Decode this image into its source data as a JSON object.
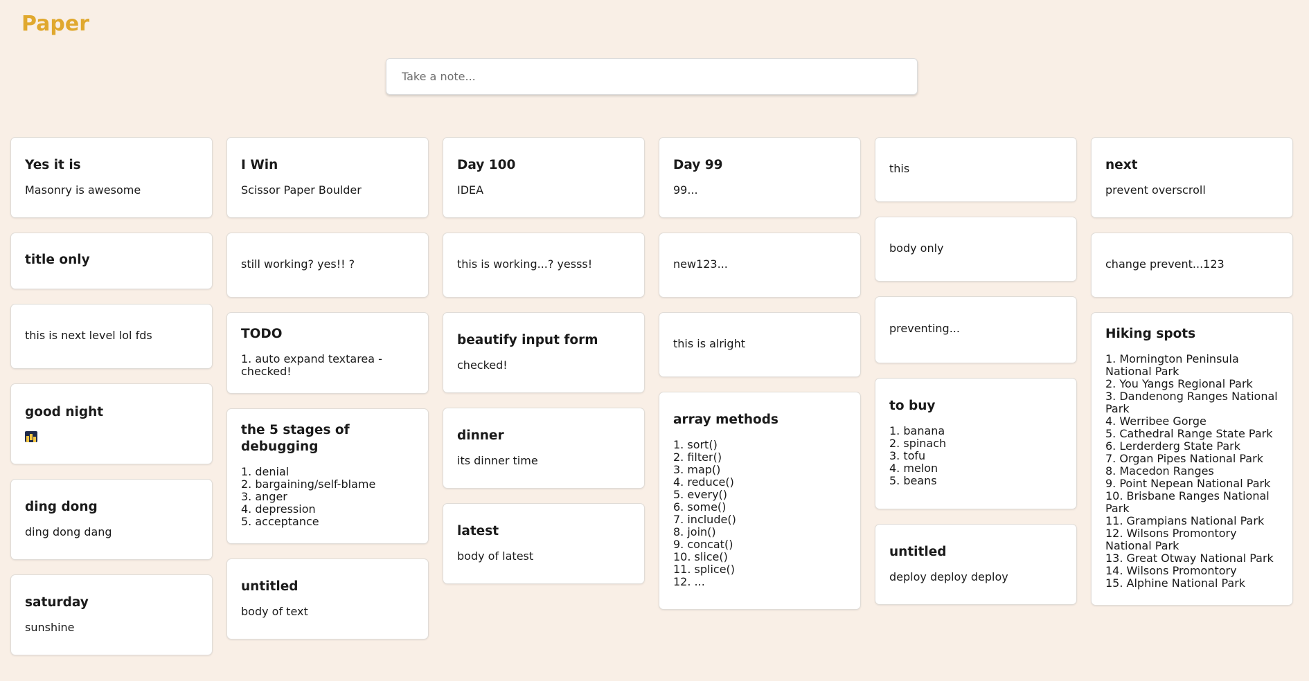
{
  "app": {
    "title": "Paper"
  },
  "input": {
    "placeholder": "Take a note..."
  },
  "columns": [
    [
      {
        "title": "Yes it is",
        "body": "Masonry is awesome"
      },
      {
        "title": "title only",
        "body": ""
      },
      {
        "title": "",
        "body": "this is next level lol fds"
      },
      {
        "title": "good night",
        "body": "",
        "icon": "night-city-icon"
      },
      {
        "title": "ding dong",
        "body": "ding dong dang"
      },
      {
        "title": "saturday",
        "body": "sunshine"
      }
    ],
    [
      {
        "title": "I Win",
        "body": "Scissor Paper Boulder"
      },
      {
        "title": "",
        "body": "still working? yes!! ?"
      },
      {
        "title": "TODO",
        "body": "1. auto expand textarea - checked!"
      },
      {
        "title": "the 5 stages of debugging",
        "body": "1. denial\n2. bargaining/self-blame\n3. anger\n4. depression\n5. acceptance"
      },
      {
        "title": "untitled",
        "body": "body of text"
      }
    ],
    [
      {
        "title": "Day 100",
        "body": "IDEA"
      },
      {
        "title": "",
        "body": "this is working...? yesss!"
      },
      {
        "title": "beautify input form",
        "body": "checked!"
      },
      {
        "title": "dinner",
        "body": "its dinner time"
      },
      {
        "title": "latest",
        "body": "body of latest"
      }
    ],
    [
      {
        "title": "Day 99",
        "body": "99..."
      },
      {
        "title": "",
        "body": "new123..."
      },
      {
        "title": "",
        "body": "this is alright"
      },
      {
        "title": "array methods",
        "body": "1. sort()\n2. filter()\n3. map()\n4. reduce()\n5. every()\n6. some()\n7. include()\n8. join()\n9. concat()\n10. slice()\n11. splice()\n12. ..."
      }
    ],
    [
      {
        "title": "",
        "body": "this"
      },
      {
        "title": "",
        "body": "body only"
      },
      {
        "title": "",
        "body": "preventing..."
      },
      {
        "title": "to buy",
        "body": "1. banana\n2. spinach\n3. tofu\n4. melon\n5. beans"
      },
      {
        "title": "untitled",
        "body": "deploy deploy deploy"
      }
    ],
    [
      {
        "title": "next",
        "body": "prevent overscroll"
      },
      {
        "title": "",
        "body": "change prevent...123"
      },
      {
        "title": "Hiking spots",
        "body": "1. Mornington Peninsula National Park\n2. You Yangs Regional Park\n3. Dandenong Ranges National Park\n4. Werribee Gorge\n5. Cathedral Range State Park\n6. Lerderderg State Park\n7. Organ Pipes National Park\n8. Macedon Ranges\n9. Point Nepean National Park\n10. Brisbane Ranges National Park\n11. Grampians National Park\n12. Wilsons Promontory National Park\n13. Great Otway National Park\n14. Wilsons Promontory\n15. Alphine National Park"
      }
    ]
  ]
}
